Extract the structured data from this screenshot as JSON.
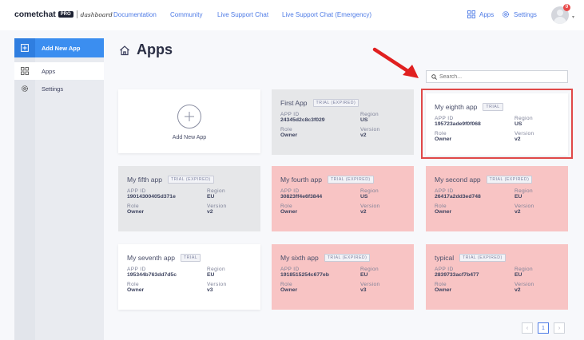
{
  "nav": {
    "logo_word": "cometchat",
    "logo_pro": "PRO",
    "logo_dashboard": "dashboard",
    "links": [
      "Documentation",
      "Community",
      "Live Support Chat",
      "Live Support Chat (Emergency)"
    ],
    "apps_label": "Apps",
    "settings_label": "Settings",
    "notification_count": "0"
  },
  "sidebar": {
    "add_label": "Add New App",
    "items": [
      {
        "label": "Apps",
        "icon": "grid-icon"
      },
      {
        "label": "Settings",
        "icon": "gear-icon"
      }
    ]
  },
  "main": {
    "title": "Apps",
    "search_placeholder": "Search..."
  },
  "add_card": {
    "label": "Add New App"
  },
  "cards": [
    {
      "name": "First App",
      "tag": "TRIAL (EXPIRED)",
      "app_id_label": "APP ID",
      "app_id": "24345d2c8c3f029",
      "region_label": "Region",
      "region": "US",
      "role_label": "Role",
      "role": "Owner",
      "version_label": "Version",
      "version": "v2",
      "style": "grey"
    },
    {
      "name": "My eighth app",
      "tag": "TRIAL",
      "app_id_label": "APP ID",
      "app_id": "195723ade9f0f068",
      "region_label": "Region",
      "region": "US",
      "role_label": "Role",
      "role": "Owner",
      "version_label": "Version",
      "version": "v2",
      "style": "white"
    },
    {
      "name": "My fifth app",
      "tag": "TRIAL (EXPIRED)",
      "app_id_label": "APP ID",
      "app_id": "19014300405d371e",
      "region_label": "Region",
      "region": "EU",
      "role_label": "Role",
      "role": "Owner",
      "version_label": "Version",
      "version": "v2",
      "style": "grey"
    },
    {
      "name": "My fourth app",
      "tag": "TRIAL (EXPIRED)",
      "app_id_label": "APP ID",
      "app_id": "30823ff4e6f3844",
      "region_label": "Region",
      "region": "US",
      "role_label": "Role",
      "role": "Owner",
      "version_label": "Version",
      "version": "v2",
      "style": "red"
    },
    {
      "name": "My second app",
      "tag": "TRIAL (EXPIRED)",
      "app_id_label": "APP ID",
      "app_id": "26417a2dd3ed748",
      "region_label": "Region",
      "region": "EU",
      "role_label": "Role",
      "role": "Owner",
      "version_label": "Version",
      "version": "v2",
      "style": "red"
    },
    {
      "name": "My seventh app",
      "tag": "TRIAL",
      "app_id_label": "APP ID",
      "app_id": "195344b763dd7d5c",
      "region_label": "Region",
      "region": "EU",
      "role_label": "Role",
      "role": "Owner",
      "version_label": "Version",
      "version": "v3",
      "style": "white"
    },
    {
      "name": "My sixth app",
      "tag": "TRIAL (EXPIRED)",
      "app_id_label": "APP ID",
      "app_id": "1918515254c677eb",
      "region_label": "Region",
      "region": "EU",
      "role_label": "Role",
      "role": "Owner",
      "version_label": "Version",
      "version": "v3",
      "style": "red"
    },
    {
      "name": "typical",
      "tag": "TRIAL (EXPIRED)",
      "app_id_label": "APP ID",
      "app_id": "2839733acf7b477",
      "region_label": "Region",
      "region": "EU",
      "role_label": "Role",
      "role": "Owner",
      "version_label": "Version",
      "version": "v2",
      "style": "red"
    }
  ],
  "pagination": {
    "prev": "‹",
    "current": "1",
    "next": "›"
  },
  "colors": {
    "accent": "#3b8ef0",
    "link": "#4e7be6",
    "expired_card": "#f8c4c4",
    "highlight": "#e04848"
  }
}
